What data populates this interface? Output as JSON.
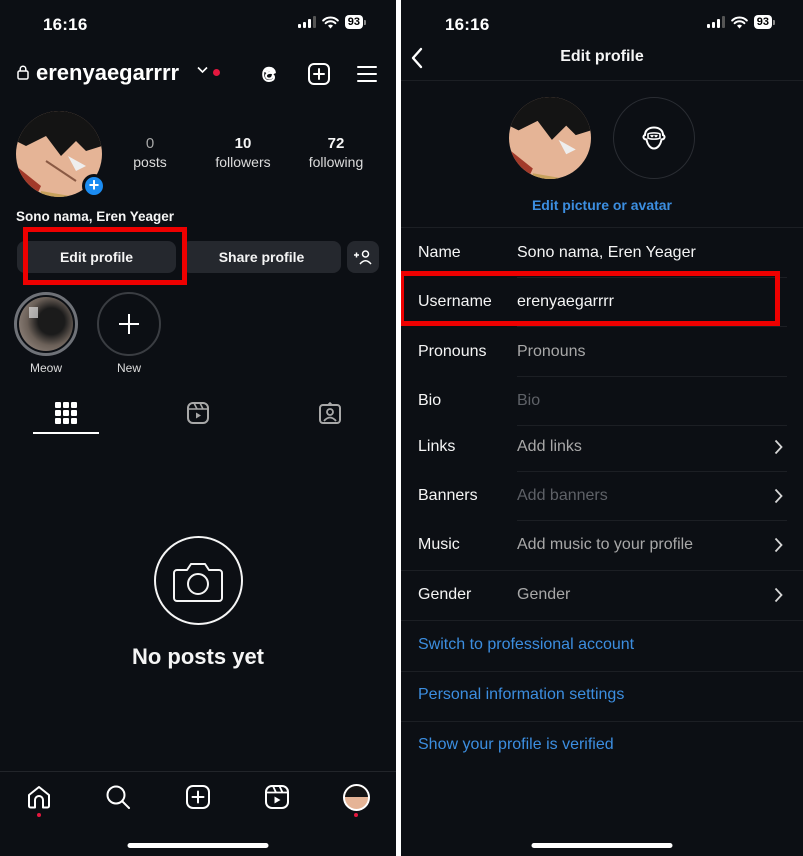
{
  "status_bar": {
    "time": "16:16",
    "battery": "93"
  },
  "profile_screen": {
    "username": "erenyaegarrrr",
    "stats": [
      {
        "value": "0",
        "label": "posts"
      },
      {
        "value": "10",
        "label": "followers"
      },
      {
        "value": "72",
        "label": "following"
      }
    ],
    "full_name": "Sono nama, Eren Yeager",
    "buttons": {
      "edit": "Edit profile",
      "share": "Share profile"
    },
    "highlights": [
      {
        "label": "Meow"
      },
      {
        "label": "New"
      }
    ],
    "tabs": [
      "grid",
      "reels",
      "tagged"
    ],
    "empty_state": {
      "title": "No posts yet"
    },
    "bottom_nav": [
      "home",
      "search",
      "create",
      "reels",
      "profile"
    ]
  },
  "edit_screen": {
    "title": "Edit profile",
    "edit_picture_label": "Edit picture or avatar",
    "fields": [
      {
        "label": "Name",
        "value": "Sono nama, Eren Yeager",
        "placeholder": false,
        "chevron": false
      },
      {
        "label": "Username",
        "value": "erenyaegarrrr",
        "placeholder": false,
        "chevron": false
      },
      {
        "label": "Pronouns",
        "value": "Pronouns",
        "placeholder": true,
        "chevron": false
      },
      {
        "label": "Bio",
        "value": "Bio",
        "placeholder": true,
        "chevron": false
      },
      {
        "label": "Links",
        "value": "Add links",
        "placeholder": true,
        "chevron": true
      },
      {
        "label": "Banners",
        "value": "Add banners",
        "placeholder": true,
        "chevron": true
      },
      {
        "label": "Music",
        "value": "Add music to your profile",
        "placeholder": true,
        "chevron": true
      },
      {
        "label": "Gender",
        "value": "Gender",
        "placeholder": true,
        "chevron": true
      }
    ],
    "links": [
      "Switch to professional account",
      "Personal information settings",
      "Show your profile is verified"
    ]
  },
  "colors": {
    "accent_blue": "#3c8ee0",
    "annotation_red": "#ee0000",
    "notification_red": "#e4173e",
    "background": "#0c0f14"
  }
}
